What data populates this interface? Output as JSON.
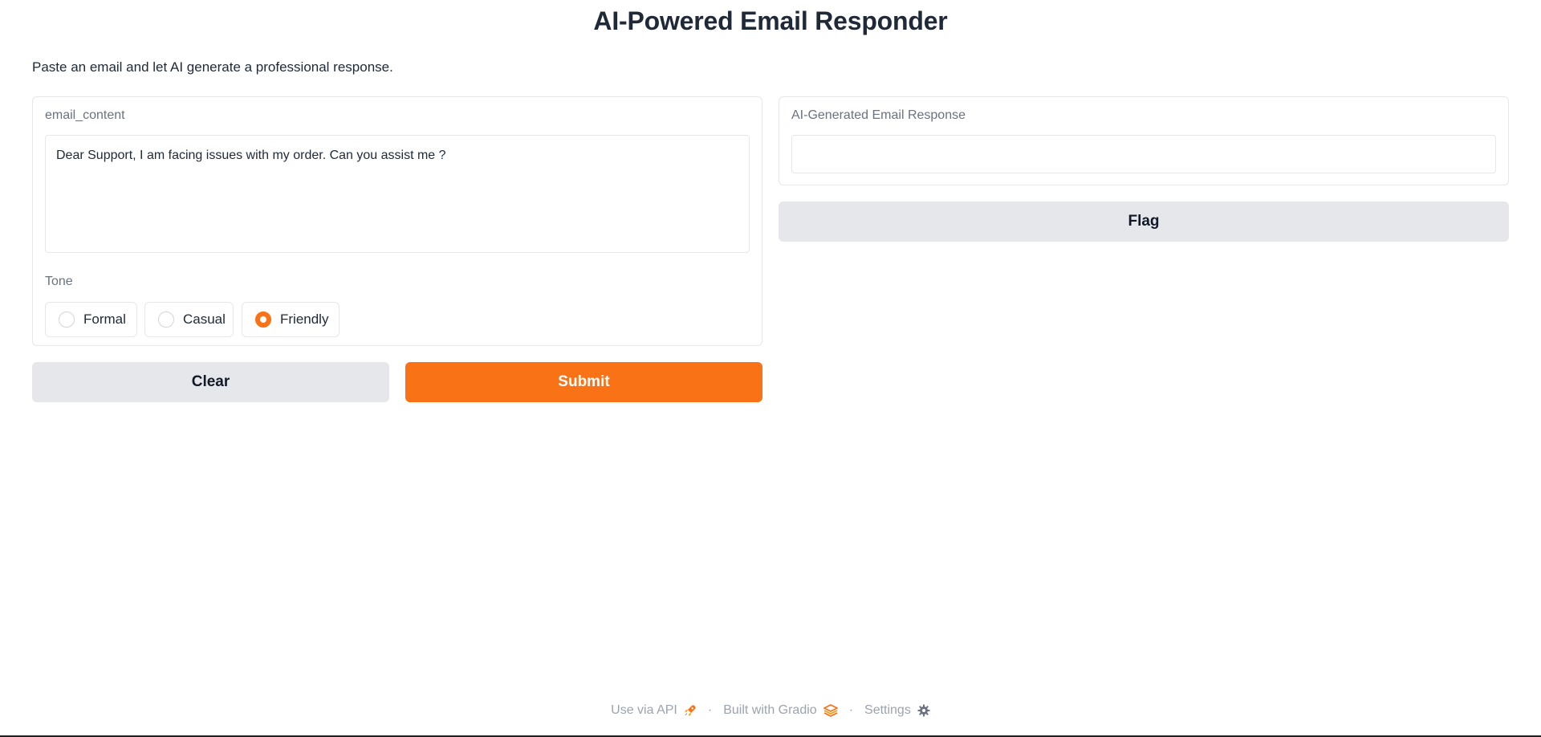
{
  "app": {
    "title": "AI-Powered Email Responder",
    "description": "Paste an email and let AI generate a professional response."
  },
  "input": {
    "label": "email_content",
    "value": "Dear Support, I am facing issues with my order. Can you assist me ?"
  },
  "tone": {
    "label": "Tone",
    "options": [
      "Formal",
      "Casual",
      "Friendly"
    ],
    "selected": "Friendly"
  },
  "actions": {
    "clear_label": "Clear",
    "submit_label": "Submit"
  },
  "output": {
    "label": "AI-Generated Email Response",
    "value": "",
    "flag_label": "Flag"
  },
  "footer": {
    "api_label": "Use via API",
    "built_label": "Built with Gradio",
    "settings_label": "Settings",
    "separator": "·",
    "icons": [
      "rocket-icon",
      "gradio-logo-icon",
      "gear-icon"
    ]
  },
  "colors": {
    "accent": "#f97316",
    "secondary_button": "#e5e7eb",
    "border": "#e5e7eb",
    "muted_text": "#6b7280"
  }
}
